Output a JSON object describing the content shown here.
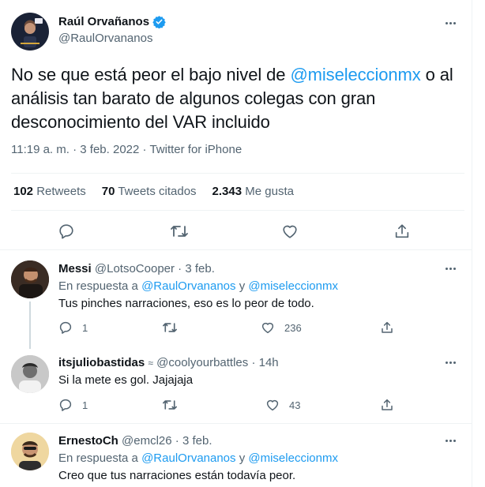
{
  "main_tweet": {
    "display_name": "Raúl Orvañanos",
    "handle": "@RaulOrvananos",
    "text_before": "No se que está peor el bajo nivel de ",
    "mention": "@miseleccionmx",
    "text_after": " o al análisis tan barato de algunos colegas con gran desconocimiento del VAR incluido",
    "time": "11:19 a. m.",
    "date": "3 feb. 2022",
    "source": "Twitter for iPhone",
    "retweets_count": "102",
    "retweets_label": "Retweets",
    "quotes_count": "70",
    "quotes_label": "Tweets citados",
    "likes_count": "2.343",
    "likes_label": "Me gusta"
  },
  "replies": [
    {
      "display_name": "Messi",
      "handle": "@LotsoCooper",
      "sep": "·",
      "time": "3 feb.",
      "reply_prefix": "En respuesta a",
      "reply_user1": "@RaulOrvananos",
      "reply_and": "y",
      "reply_user2": "@miseleccionmx",
      "text": "Tus pinches narraciones, eso es lo peor de todo.",
      "reply_count": "1",
      "like_count": "236"
    },
    {
      "display_name": "itsjuliobastidas",
      "badge": "≈",
      "handle": "@coolyourbattles",
      "sep": "·",
      "time": "14h",
      "text": "Si la mete es gol. Jajajaja",
      "reply_count": "1",
      "like_count": "43"
    },
    {
      "display_name": "ErnestoCh",
      "handle": "@emcl26",
      "sep": "·",
      "time": "3 feb.",
      "reply_prefix": "En respuesta a",
      "reply_user1": "@RaulOrvananos",
      "reply_and": "y",
      "reply_user2": "@miseleccionmx",
      "text": "Creo que tus narraciones están todavía peor."
    }
  ],
  "colors": {
    "accent": "#1d9bf0",
    "text": "#0f1419",
    "muted": "#536471",
    "divider": "#eff3f4"
  }
}
